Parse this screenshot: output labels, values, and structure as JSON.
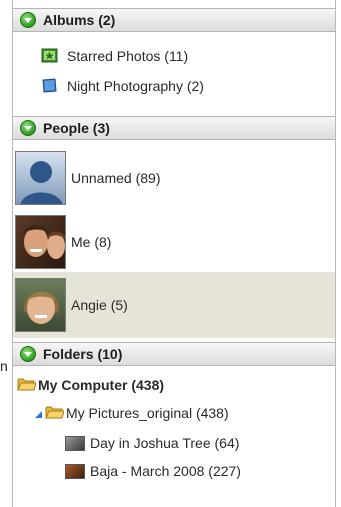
{
  "colors": {
    "toggle": "#2c9e22",
    "selected_row": "#e6e3d8",
    "header_bg": "#dcdcdc",
    "expander": "#2d78c9"
  },
  "cut_label_left": "n",
  "sections": {
    "albums": {
      "header": "Albums (2)",
      "items": [
        {
          "label": "Starred Photos (11)",
          "icon": "starred-album-icon"
        },
        {
          "label": "Night Photography (2)",
          "icon": "album-book-icon"
        }
      ]
    },
    "people": {
      "header": "People (3)",
      "items": [
        {
          "label": "Unnamed (89)",
          "icon": "unknown-person-avatar",
          "selected": false
        },
        {
          "label": "Me (8)",
          "icon": "person-photo-me",
          "selected": false
        },
        {
          "label": "Angie (5)",
          "icon": "person-photo-angie",
          "selected": true
        }
      ]
    },
    "folders": {
      "header": "Folders (10)",
      "items": [
        {
          "label": "My Computer (438)",
          "icon": "folder-icon"
        },
        {
          "label": "My Pictures_original (438)",
          "icon": "folder-icon"
        },
        {
          "label": "Day in Joshua Tree (64)",
          "icon": "photo-folder-icon"
        },
        {
          "label": "Baja - March 2008 (227)",
          "icon": "photo-folder-icon"
        }
      ]
    }
  }
}
